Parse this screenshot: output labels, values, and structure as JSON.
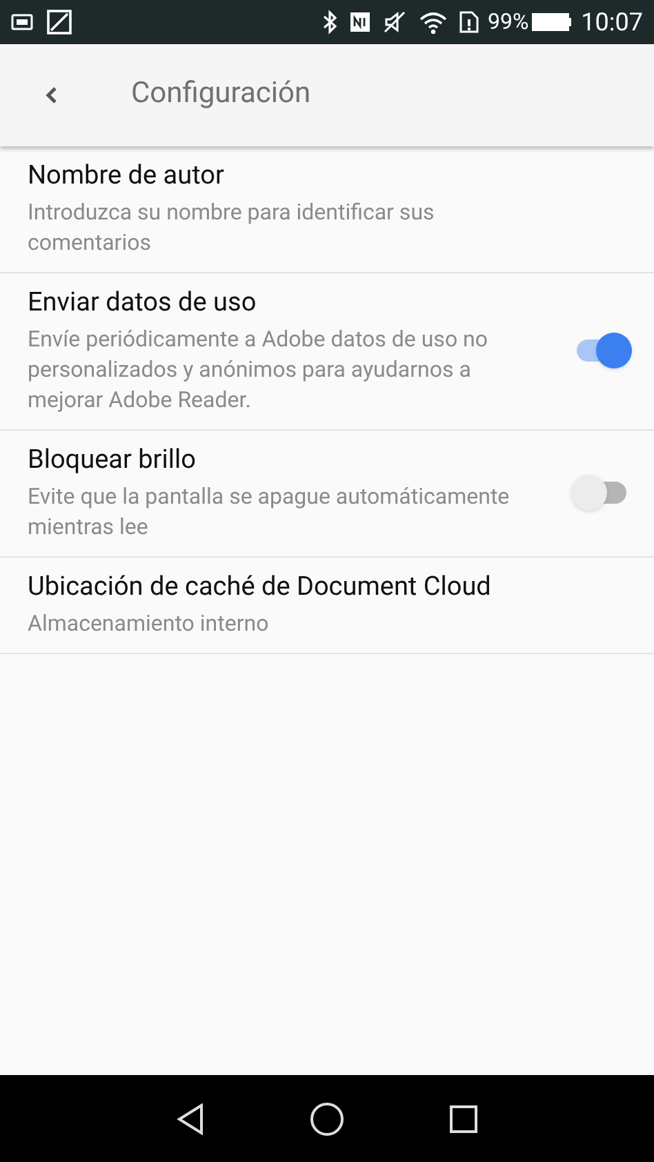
{
  "status_bar": {
    "battery": "99%",
    "time": "10:07"
  },
  "app_bar": {
    "title": "Configuración"
  },
  "settings": [
    {
      "kind": "text",
      "title": "Nombre de autor",
      "subtitle": "Introduzca su nombre para identificar sus comentarios"
    },
    {
      "kind": "toggle",
      "title": "Enviar datos de uso",
      "subtitle": "Envíe periódicamente a Adobe datos de uso no personalizados y anónimos para ayudarnos a mejorar Adobe Reader.",
      "on": true
    },
    {
      "kind": "toggle",
      "title": "Bloquear brillo",
      "subtitle": "Evite que la pantalla se apague automáticamente mientras lee",
      "on": false
    },
    {
      "kind": "text",
      "title": "Ubicación de caché de Document Cloud",
      "subtitle": "Almacenamiento interno"
    }
  ]
}
